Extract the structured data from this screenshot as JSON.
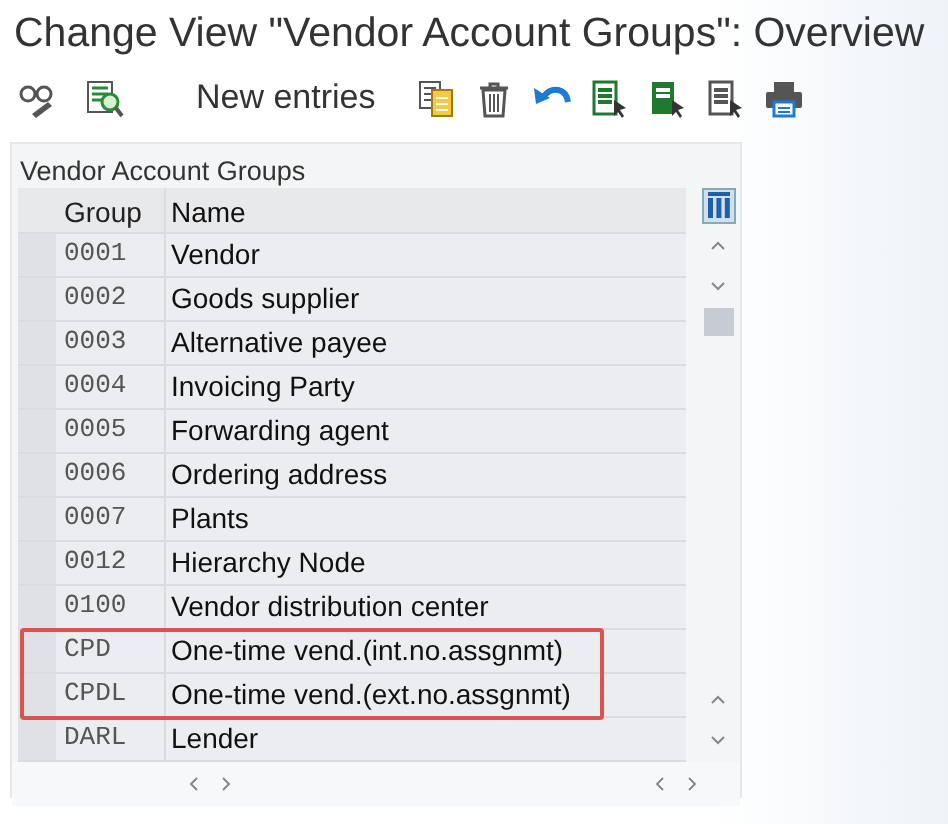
{
  "window": {
    "title": "Change View \"Vendor Account Groups\": Overview"
  },
  "toolbar": {
    "items": [
      {
        "kind": "glasses"
      },
      {
        "kind": "display"
      },
      {
        "kind": "text",
        "label": "New entries"
      },
      {
        "kind": "copy"
      },
      {
        "kind": "trash"
      },
      {
        "kind": "undo"
      },
      {
        "kind": "select-all"
      },
      {
        "kind": "select-block"
      },
      {
        "kind": "deselect"
      },
      {
        "kind": "print"
      }
    ]
  },
  "panel": {
    "title": "Vendor Account Groups"
  },
  "table": {
    "columns": [
      "Group",
      "Name"
    ],
    "rows": [
      {
        "group": "0001",
        "name": "Vendor",
        "highlighted": false
      },
      {
        "group": "0002",
        "name": "Goods supplier",
        "highlighted": false
      },
      {
        "group": "0003",
        "name": "Alternative payee",
        "highlighted": false
      },
      {
        "group": "0004",
        "name": "Invoicing Party",
        "highlighted": false
      },
      {
        "group": "0005",
        "name": "Forwarding agent",
        "highlighted": false
      },
      {
        "group": "0006",
        "name": "Ordering address",
        "highlighted": false
      },
      {
        "group": "0007",
        "name": "Plants",
        "highlighted": false
      },
      {
        "group": "0012",
        "name": "Hierarchy Node",
        "highlighted": false
      },
      {
        "group": "0100",
        "name": "Vendor distribution center",
        "highlighted": false
      },
      {
        "group": "CPD",
        "name": "One-time vend.(int.no.assgnmt)",
        "highlighted": true
      },
      {
        "group": "CPDL",
        "name": "One-time vend.(ext.no.assgnmt)",
        "highlighted": true
      },
      {
        "group": "DARL",
        "name": "Lender",
        "highlighted": false
      }
    ]
  }
}
